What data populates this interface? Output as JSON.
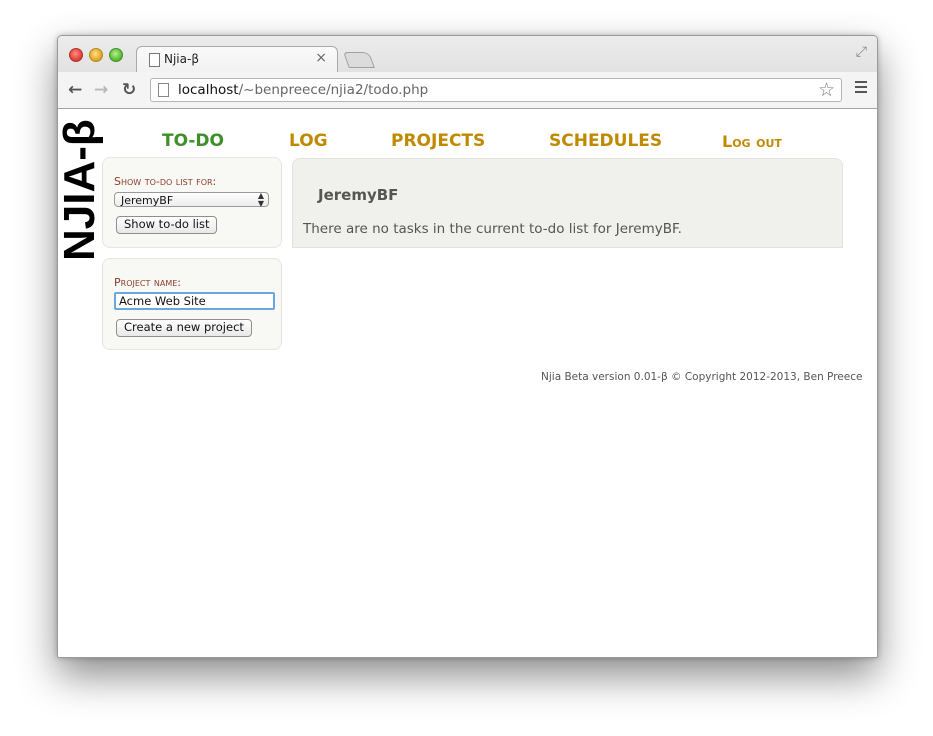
{
  "browser": {
    "tab_title": "Njia-β",
    "tab_close": "×",
    "url_host": "localhost",
    "url_path": "/~benpreece/njia2/todo.php",
    "back_icon": "back-arrow-icon",
    "forward_icon": "forward-arrow-icon",
    "reload_icon": "reload-icon",
    "bookmark_icon": "star-icon",
    "menu_icon": "hamburger-menu-icon"
  },
  "site": {
    "logo": "NJIA-β",
    "nav": {
      "todo": "TO-DO",
      "log": "LOG",
      "projects": "PROJECTS",
      "schedules": "SCHEDULES",
      "logout": "Log out"
    },
    "colors": {
      "nav_active": "#3f8f2a",
      "nav_link": "#c08a00",
      "label": "#8a3d2d"
    }
  },
  "todo_panel": {
    "label": "Show to-do list for:",
    "selected_user": "JeremyBF",
    "button": "Show to-do list"
  },
  "project_panel": {
    "label": "Project name:",
    "input_value": "Acme Web Site",
    "button": "Create a new project"
  },
  "content": {
    "user": "JeremyBF",
    "message": "There are no tasks in the current to-do list for JeremyBF."
  },
  "footer": {
    "text": "Njia Beta version 0.01-β © Copyright 2012-2013, Ben Preece"
  }
}
